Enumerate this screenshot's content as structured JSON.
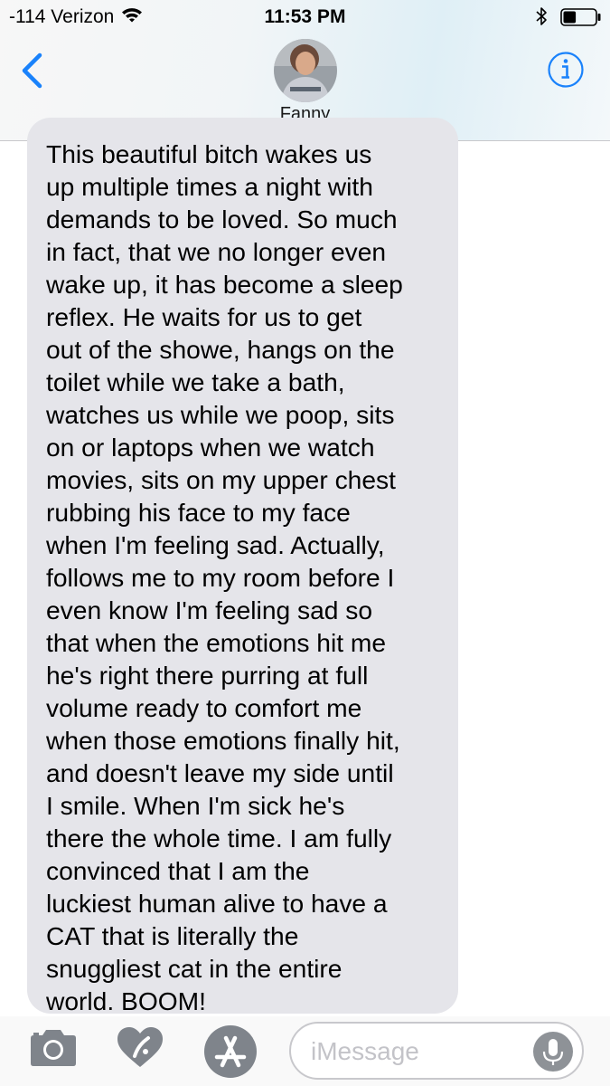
{
  "status_bar": {
    "carrier": "-114 Verizon",
    "time": "11:53 PM",
    "battery_level": 0.4
  },
  "header": {
    "contact_name": "Fanny",
    "back_icon": "chevron-left-icon",
    "info_icon": "info-icon",
    "accent_color": "#1a82fb"
  },
  "message": {
    "text": "This beautiful bitch wakes us\nup multiple times a night with\ndemands to be loved. So much\nin fact, that we no longer even\nwake up, it has become a sleep\nreflex. He waits for us to get\nout of the showe, hangs on the\ntoilet while we take a bath,\nwatches us while we poop, sits\non or laptops when we watch\nmovies, sits on my upper chest\nrubbing his face to my face\nwhen I'm feeling sad. Actually,\nfollows me to my room before I\neven know I'm feeling sad so\nthat when the emotions hit me\nhe's right there purring at full\nvolume ready to comfort me\nwhen those emotions finally hit,\nand doesn't leave my side until\nI smile. When I'm sick he's\nthere the whole time. I am fully\nconvinced that I am the\nluckiest human alive to have a\nCAT that is literally the\nsnuggliest cat in the entire\nworld. BOOM!",
    "bubble_color": "#e5e5ea"
  },
  "input_bar": {
    "placeholder": "iMessage",
    "icons": [
      "camera-icon",
      "digital-touch-heart-icon",
      "app-store-icon",
      "microphone-icon"
    ]
  }
}
